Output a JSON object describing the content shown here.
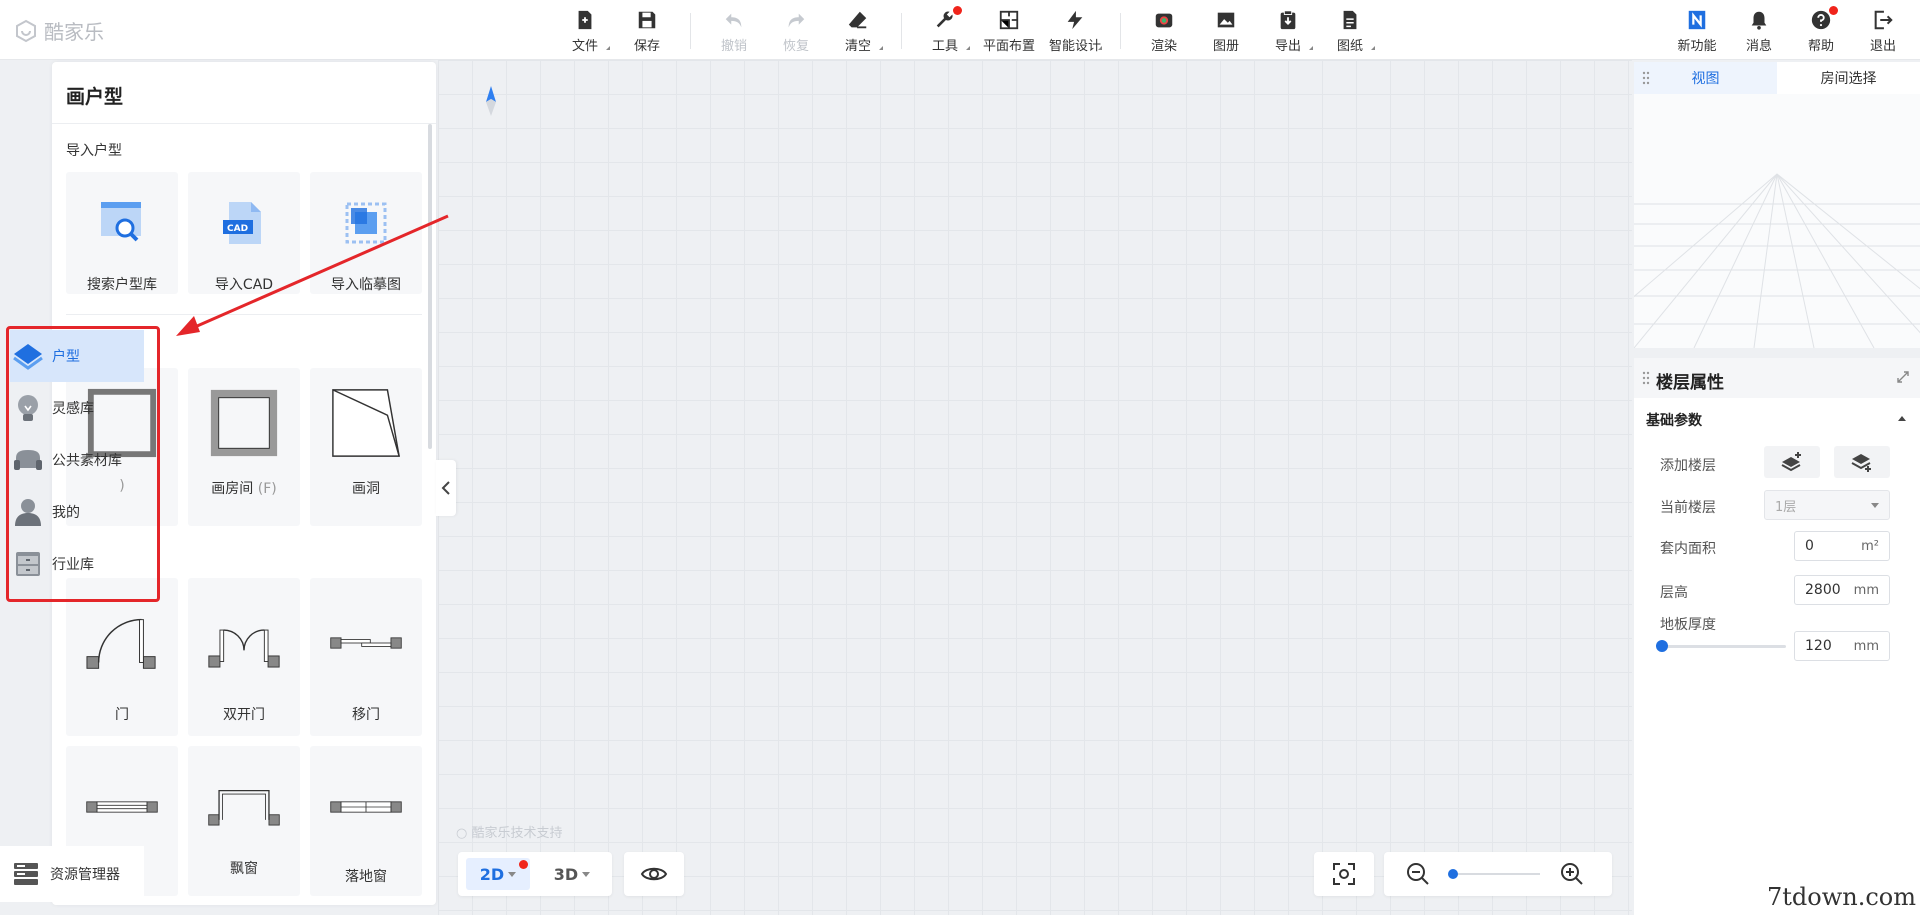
{
  "app": {
    "logo_text": "酷家乐"
  },
  "toolbar": {
    "groups": [
      [
        {
          "label": "文件",
          "icon": "file-icon",
          "caret": true
        },
        {
          "label": "保存",
          "icon": "save-icon"
        }
      ],
      [
        {
          "label": "撤销",
          "icon": "undo-icon",
          "disabled": true
        },
        {
          "label": "恢复",
          "icon": "redo-icon",
          "disabled": true
        },
        {
          "label": "清空",
          "icon": "eraser-icon",
          "caret": true
        }
      ],
      [
        {
          "label": "工具",
          "icon": "wrench-icon",
          "caret": true,
          "dot": true
        },
        {
          "label": "平面布置",
          "icon": "layout-icon"
        },
        {
          "label": "智能设计",
          "icon": "lightning-icon",
          "caret": true
        }
      ],
      [
        {
          "label": "渲染",
          "icon": "camera-icon"
        },
        {
          "label": "图册",
          "icon": "album-icon"
        },
        {
          "label": "导出",
          "icon": "export-icon",
          "caret": true
        },
        {
          "label": "图纸",
          "icon": "drawing-icon",
          "caret": true
        }
      ]
    ],
    "right": [
      {
        "label": "新功能",
        "icon": "new-feature-icon"
      },
      {
        "label": "消息",
        "icon": "bell-icon"
      },
      {
        "label": "帮助",
        "icon": "help-icon",
        "dot": true
      },
      {
        "label": "退出",
        "icon": "logout-icon"
      }
    ]
  },
  "left_panel": {
    "title": "画户型",
    "import_section": "导入户型",
    "import_items": [
      {
        "label": "搜索户型库",
        "icon": "search-floorplan-icon"
      },
      {
        "label": "导入CAD",
        "icon": "cad-file-icon",
        "badge": "CAD"
      },
      {
        "label": "导入临摹图",
        "icon": "trace-image-icon"
      }
    ],
    "draw_items": [
      {
        "label": "",
        "hint": ")",
        "icon": "draw-wall-icon"
      },
      {
        "label": "画房间",
        "hint": "(F)",
        "icon": "draw-room-icon"
      },
      {
        "label": "画洞",
        "hint": "",
        "icon": "draw-hole-icon"
      }
    ],
    "door_items": [
      {
        "label": "门",
        "icon": "door-icon"
      },
      {
        "label": "双开门",
        "icon": "double-door-icon"
      },
      {
        "label": "移门",
        "icon": "sliding-door-icon"
      }
    ],
    "window_items": [
      {
        "label": "",
        "icon": "window-icon"
      },
      {
        "label": "飘窗",
        "icon": "bay-window-icon"
      },
      {
        "label": "落地窗",
        "icon": "french-window-icon"
      }
    ]
  },
  "side_nav": [
    {
      "label": "户型",
      "icon": "floorplan-nav-icon",
      "active": true
    },
    {
      "label": "灵感库",
      "icon": "inspiration-nav-icon"
    },
    {
      "label": "公共素材库",
      "icon": "material-nav-icon"
    },
    {
      "label": "我的",
      "icon": "user-nav-icon"
    },
    {
      "label": "行业库",
      "icon": "industry-nav-icon"
    }
  ],
  "resource_manager": "资源管理器",
  "canvas": {
    "watermark": "酷家乐技术支持"
  },
  "bottom_bar": {
    "view_2d": "2D",
    "view_3d": "3D",
    "zoom_level": 0
  },
  "view_panel": {
    "tabs": [
      {
        "label": "视图",
        "active": true
      },
      {
        "label": "房间选择"
      }
    ]
  },
  "floor_panel": {
    "title": "楼层属性",
    "section": "基础参数",
    "add_floor_label": "添加楼层",
    "current_floor_label": "当前楼层",
    "current_floor_value": "1层",
    "area_label": "套内面积",
    "area_value": "0",
    "area_unit": "m²",
    "height_label": "层高",
    "height_value": "2800",
    "height_unit": "mm",
    "thickness_label": "地板厚度",
    "thickness_value": "120",
    "thickness_unit": "mm"
  },
  "site_mark": "7tdown.com",
  "colors": {
    "accent": "#1f6fe0",
    "alert": "#e4262a"
  }
}
